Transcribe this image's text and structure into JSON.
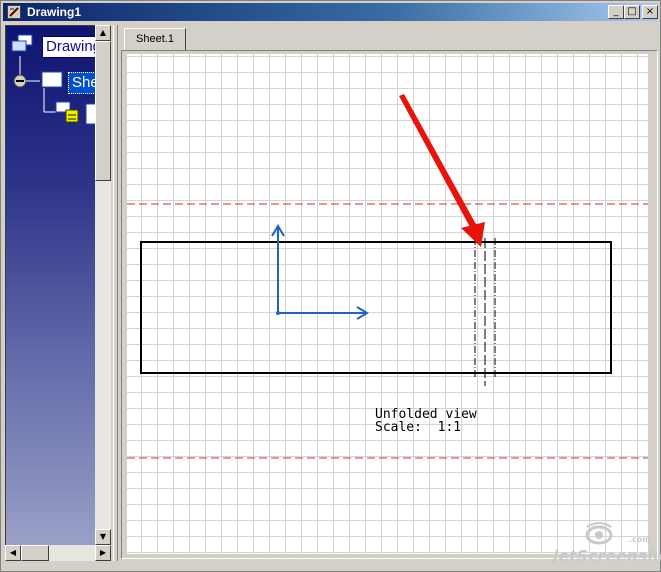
{
  "window": {
    "title": "Drawing1",
    "controls": {
      "minimize": "_",
      "maximize": "□",
      "close": "×"
    }
  },
  "tree": {
    "items": [
      {
        "label": "Drawing",
        "icon": "drawing-icon"
      },
      {
        "label": "Shee",
        "icon": "sheet-icon"
      },
      {
        "label": "",
        "icon": "view-icon"
      }
    ]
  },
  "tabs": [
    {
      "label": "Sheet.1",
      "active": true
    }
  ],
  "view": {
    "caption_line1": "Unfolded view",
    "caption_line2": "Scale:  1:1"
  },
  "watermark": {
    "text": "jetScreenshot",
    "suffix": ".com"
  },
  "colors": {
    "axis": "#1f62c8",
    "arrow": "#e8140c",
    "limit_line": "#d22c2c",
    "tree_bg": "#1a2080"
  }
}
